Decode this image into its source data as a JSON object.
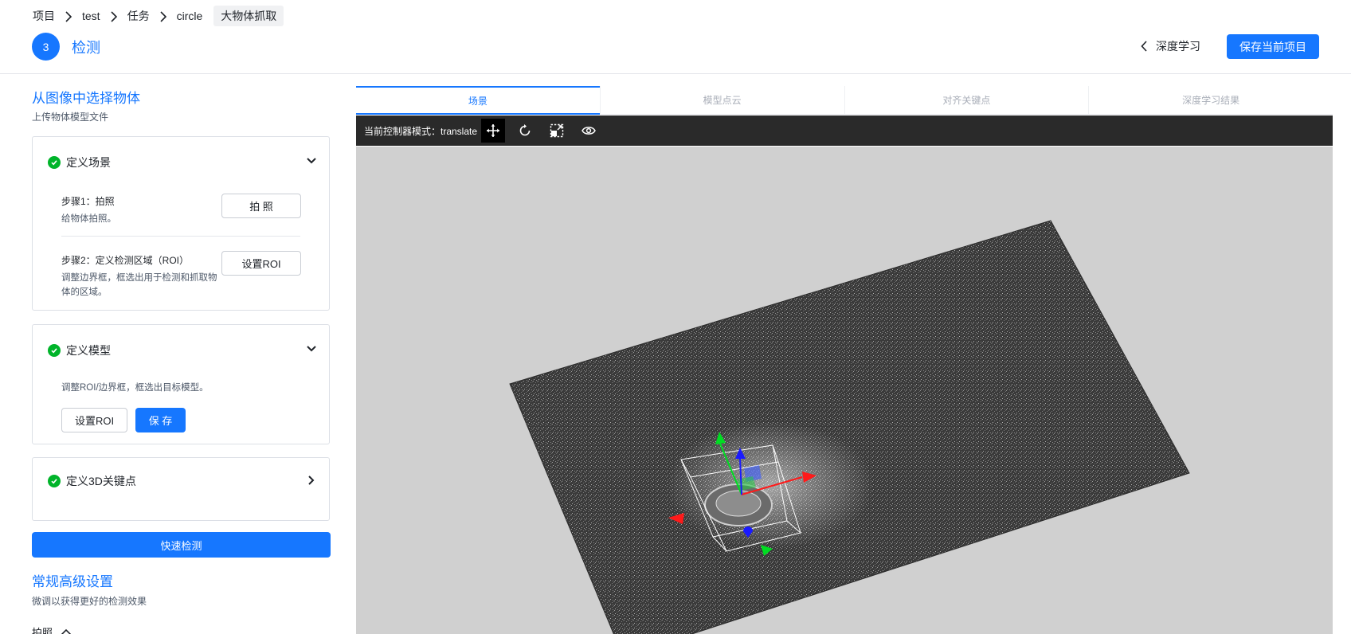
{
  "header": {
    "breadcrumb": [
      "项目",
      "test",
      "任务",
      "circle",
      "大物体抓取"
    ],
    "step_number": "3",
    "step_title": "检测",
    "back_label": "深度学习",
    "save_label": "保存当前项目"
  },
  "left": {
    "title": "从图像中选择物体",
    "subtitle": "上传物体模型文件",
    "scene_card": {
      "title": "定义场景",
      "step1_label": "步骤1：拍照",
      "step1_note": "给物体拍照。",
      "step1_button": "拍 照",
      "step2_label": "步骤2：定义检测区域（ROI）",
      "step2_note": "调整边界框，框选出用于检测和抓取物体的区域。",
      "step2_button": "设置ROI"
    },
    "model_card": {
      "title": "定义模型",
      "note": "调整ROI/边界框，框选出目标模型。",
      "roi_button": "设置ROI",
      "save_button": "保 存"
    },
    "keypoint_card": {
      "title": "定义3D关键点"
    },
    "quick_detect": "快速检测",
    "advanced_title": "常规高级设置",
    "advanced_desc": "微调以获得更好的检测效果",
    "photo_label": "拍照"
  },
  "tabs": [
    {
      "label": "场景",
      "active": true
    },
    {
      "label": "模型点云",
      "active": false
    },
    {
      "label": "对齐关键点",
      "active": false
    },
    {
      "label": "深度学习结果",
      "active": false
    }
  ],
  "toolbar": {
    "mode_label": "当前控制器模式：translate",
    "tools": [
      "move-icon",
      "rotate-icon",
      "scale-icon",
      "eye-icon"
    ]
  },
  "colors": {
    "primary": "#1677ff",
    "success": "#00b42a",
    "toolbar_bg": "#2a2a2a",
    "viewport_bg": "#d0d0d0"
  }
}
